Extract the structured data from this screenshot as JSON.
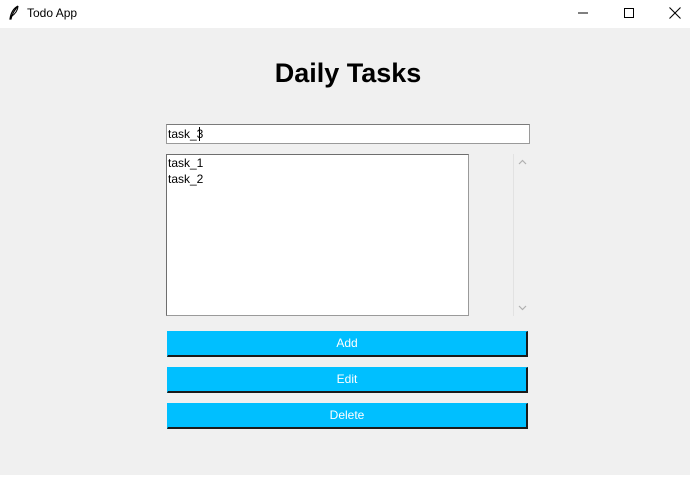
{
  "window": {
    "title": "Todo App"
  },
  "heading": "Daily Tasks",
  "task_input": {
    "value": "task_3"
  },
  "tasks": [
    "task_1",
    "task_2"
  ],
  "buttons": {
    "add": "Add",
    "edit": "Edit",
    "delete": "Delete"
  },
  "colors": {
    "button_bg": "#00bfff",
    "button_text": "#ffffff",
    "window_bg": "#f0f0f0"
  }
}
